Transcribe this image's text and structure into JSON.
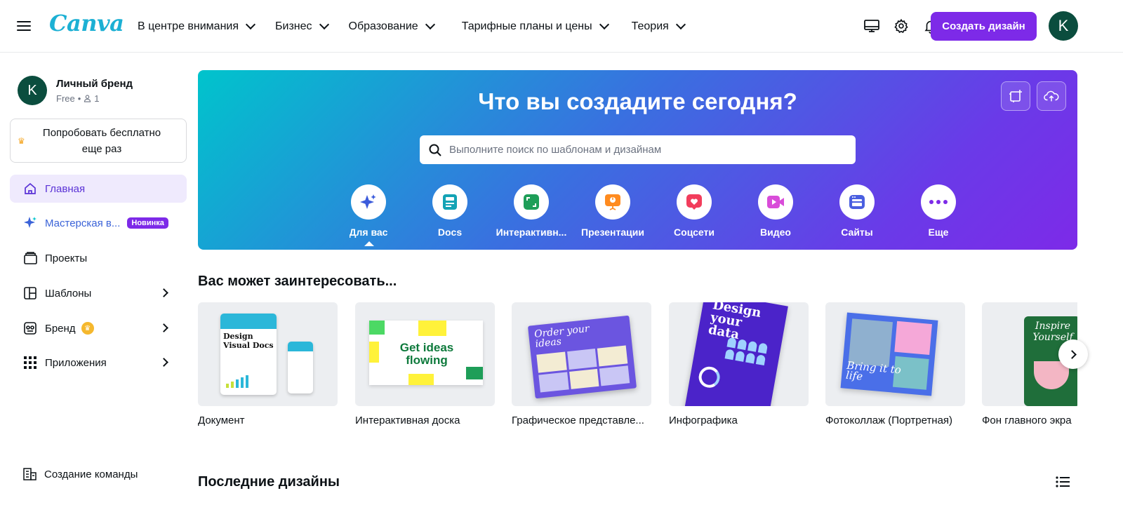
{
  "header": {
    "logo": "Canva",
    "nav": [
      {
        "label": "В центре внимания"
      },
      {
        "label": "Бизнес"
      },
      {
        "label": "Образование"
      },
      {
        "label": "Тарифные планы и цены"
      },
      {
        "label": "Теория"
      }
    ],
    "create_label": "Создать дизайн",
    "avatar_letter": "K"
  },
  "sidebar": {
    "profile": {
      "letter": "K",
      "name": "Личный бренд",
      "plan": "Free",
      "members": "1"
    },
    "trial_label": "Попробовать бесплатно еще раз",
    "items": [
      {
        "label": "Главная"
      },
      {
        "label": "Мастерская в...",
        "badge": "Новинка"
      },
      {
        "label": "Проекты"
      },
      {
        "label": "Шаблоны"
      },
      {
        "label": "Бренд"
      },
      {
        "label": "Приложения"
      }
    ],
    "team_label": "Создание команды"
  },
  "hero": {
    "title": "Что вы создадите сегодня?",
    "search_placeholder": "Выполните поиск по шаблонам и дизайнам",
    "categories": [
      {
        "label": "Для вас"
      },
      {
        "label": "Docs"
      },
      {
        "label": "Интерактивн..."
      },
      {
        "label": "Презентации"
      },
      {
        "label": "Соцсети"
      },
      {
        "label": "Видео"
      },
      {
        "label": "Сайты"
      },
      {
        "label": "Еще"
      }
    ]
  },
  "suggestions": {
    "title": "Вас может заинтересовать...",
    "cards": [
      {
        "label": "Документ",
        "thumb_text": "Design Visual Docs"
      },
      {
        "label": "Интерактивная доска",
        "thumb_text": "Get ideas flowing"
      },
      {
        "label": "Графическое представле...",
        "thumb_text": "Order your ideas"
      },
      {
        "label": "Инфографика",
        "thumb_text": "Design your data"
      },
      {
        "label": "Фотоколлаж (Портретная)",
        "thumb_text": "Bring it to life"
      },
      {
        "label": "Фон главного экра",
        "thumb_text": "Inspire Yourself"
      }
    ]
  },
  "recent": {
    "title": "Последние дизайны"
  },
  "colors": {
    "accent": "#7d2ae8",
    "avatar": "#0b4d3e",
    "active_bg": "#efeafd"
  }
}
